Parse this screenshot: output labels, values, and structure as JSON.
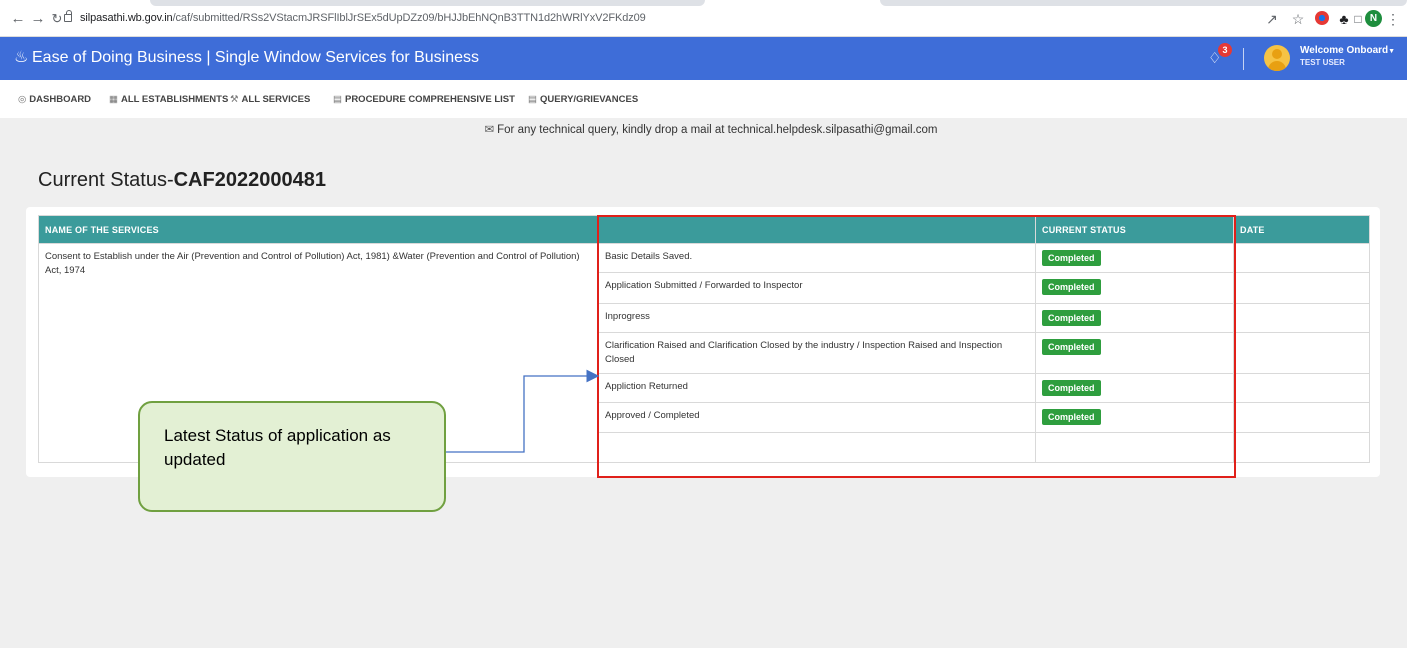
{
  "browser": {
    "url_host": "silpasathi.wb.gov.in",
    "url_path": "/caf/submitted/RSs2VStacmJRSFlIblJrSEx5dUpDZz09/bHJJbEhNQnB3TTN1d2hWRlYxV2FKdz09",
    "profile_initial": "N",
    "icons": [
      "back-icon",
      "forward-icon",
      "reload-icon",
      "lock-icon",
      "share-icon",
      "star-icon",
      "extension-icon",
      "puzzle-icon",
      "sidepanel-icon",
      "menu-icon"
    ]
  },
  "header": {
    "title": "Ease of Doing Business | Single Window Services for Business",
    "notification_count": "3",
    "welcome": "Welcome Onboard",
    "user": "TEST USER"
  },
  "nav": {
    "items": [
      {
        "label": "DASHBOARD",
        "icon": "dashboard-icon"
      },
      {
        "label": "ALL ESTABLISHMENTS",
        "icon": "building-icon"
      },
      {
        "label": "ALL SERVICES",
        "icon": "wrench-icon"
      },
      {
        "label": "PROCEDURE COMPREHENSIVE LIST",
        "icon": "list-icon"
      },
      {
        "label": "QUERY/GRIEVANCES",
        "icon": "list-icon"
      }
    ]
  },
  "helpdesk": {
    "text": "For any technical query, kindly drop a mail at technical.helpdesk.silpasathi@gmail.com"
  },
  "page": {
    "title_prefix": "Current Status-",
    "caf_id": "CAF2022000481"
  },
  "table": {
    "headers": {
      "service": "NAME OF THE SERVICES",
      "step": "",
      "status": "CURRENT STATUS",
      "date": "DATE"
    },
    "service_name": "Consent to Establish under the Air (Prevention and Control of Pollution) Act, 1981) &Water (Prevention and Control of Pollution) Act, 1974",
    "rows": [
      {
        "step": "Basic Details Saved.",
        "status": "Completed",
        "date": ""
      },
      {
        "step": "Application Submitted / Forwarded to Inspector",
        "status": "Completed",
        "date": ""
      },
      {
        "step": "Inprogress",
        "status": "Completed",
        "date": ""
      },
      {
        "step": "Clarification Raised and Clarification Closed by the industry / Inspection Raised and Inspection Closed",
        "status": "Completed",
        "date": ""
      },
      {
        "step": "Appliction Returned",
        "status": "Completed",
        "date": ""
      },
      {
        "step": "Approved / Completed",
        "status": "Completed",
        "date": ""
      },
      {
        "step": "",
        "status": "",
        "date": ""
      }
    ]
  },
  "callout": {
    "text": "Latest Status of application as updated"
  },
  "colors": {
    "header_blue": "#3e6dd8",
    "table_header_teal": "#3b9b9b",
    "badge_green": "#2e9e3e",
    "highlight_red": "#e0201a",
    "callout_fill": "#e3f0d4",
    "callout_border": "#70a040",
    "arrow_blue": "#4472c4"
  }
}
